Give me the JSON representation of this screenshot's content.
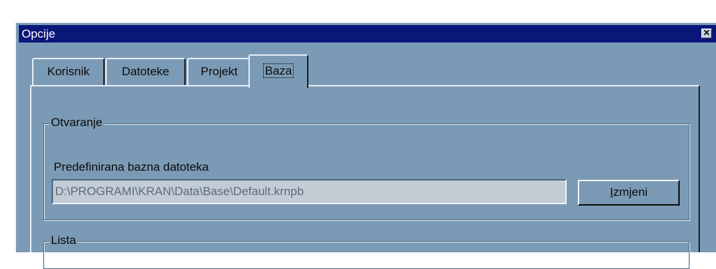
{
  "window": {
    "title": "Opcije",
    "close_glyph": "✕",
    "close_icon": "close-icon"
  },
  "tabs": [
    {
      "label": "Korisnik",
      "active": false
    },
    {
      "label": "Datoteke",
      "active": false
    },
    {
      "label": "Projekt",
      "active": false
    },
    {
      "label": "Baza",
      "active": true
    }
  ],
  "groups": {
    "otvaranje": {
      "legend": "Otvaranje",
      "field_label": "Predefinirana bazna datoteka",
      "path_value": "D:\\PROGRAMI\\KRAN\\Data\\Base\\Default.krnpb",
      "button": {
        "mnemonic": "I",
        "rest": "zmjeni"
      }
    },
    "lista": {
      "legend": "Lista"
    }
  },
  "colors": {
    "titlebar": "#0a1678",
    "window_bg": "#7b9ab5",
    "input_bg": "#c3ccd5"
  }
}
